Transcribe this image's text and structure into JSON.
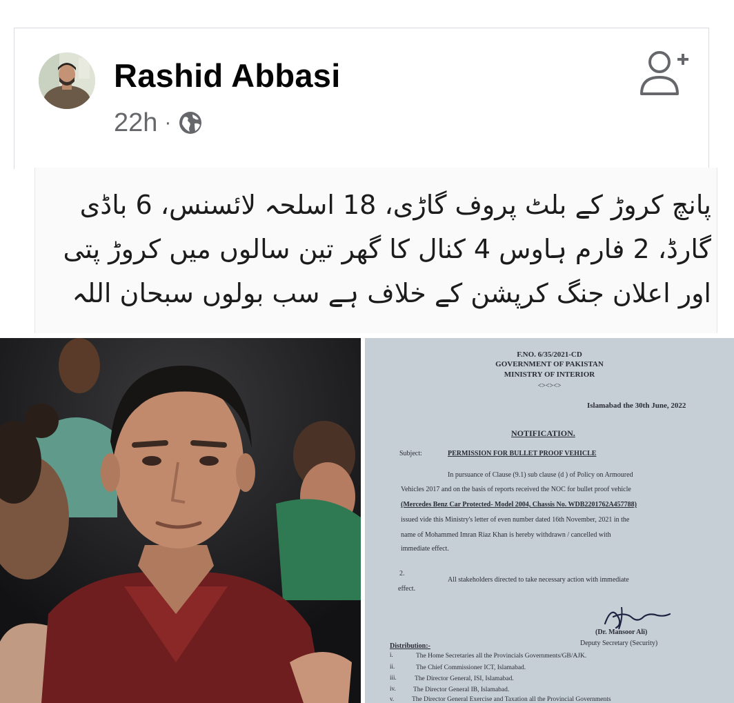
{
  "post": {
    "author": "Rashid Abbasi",
    "time": "22h",
    "separator": "·",
    "privacy_icon": "globe-icon",
    "add_friend_icon": "add-friend-icon",
    "text_lines": [
      "پانچ کروڑ کے بلٹ پروف گاڑی، 18 اسلحہ لائسنس، 6 باڈی",
      "گارڈ، 2 فارم ہاوس 4 کنال کا گھر تین سالوں میں کروڑ پتی",
      "اور اعلان جنگ کرپشن کے خلاف ہے سب بولوں سبحان اللہ"
    ]
  },
  "document": {
    "file_no": "F.NO. 6/35/2021-CD",
    "government": "GOVERNMENT OF PAKISTAN",
    "ministry": "MINISTRY OF INTERIOR",
    "ornament": "<><><>",
    "date": "Islamabad the 30th June, 2022",
    "heading": "NOTIFICATION.",
    "subject_label": "Subject:",
    "subject": "PERMISSION FOR BULLET PROOF VEHICLE",
    "para1_lines": [
      "In pursuance of Clause (9.1) sub clause (d ) of Policy on Armoured",
      "Vehicles 2017 and on the basis of reports received the NOC for bullet proof vehicle",
      "(Mercedes Benz Car Protected- Model 2004, Chassis No. WDB2201762A457788)",
      "issued vide this Ministry's letter of even number dated 16th November, 2021 in the",
      "name of Mohammed Imran Riaz Khan is hereby withdrawn / cancelled with",
      "immediate effect."
    ],
    "para2_number": "2.",
    "para2_lines": [
      "All stakeholders directed to take necessary action with immediate",
      "effect."
    ],
    "signatory_name": "(Dr. Mansoor Ali)",
    "signatory_title": "Deputy Secretary (Security)",
    "distribution_label": "Distribution:-",
    "distribution": [
      {
        "num": "i.",
        "text": "The Home Secretaries all the Provincials Governments/GB/AJK."
      },
      {
        "num": "ii.",
        "text": "The Chief Commissioner ICT, Islamabad."
      },
      {
        "num": "iii.",
        "text": "The Director General, ISI, Islamabad."
      },
      {
        "num": "iv.",
        "text": "The Director General IB, Islamabad."
      },
      {
        "num": "v.",
        "text": "The Director General Exercise and Taxation all the Provincial Governments"
      }
    ]
  },
  "colors": {
    "name": "#050505",
    "meta": "#65676b",
    "icon": "#65676b",
    "document_paper": "#c6cfd6",
    "document_ink": "#2a2c33"
  }
}
